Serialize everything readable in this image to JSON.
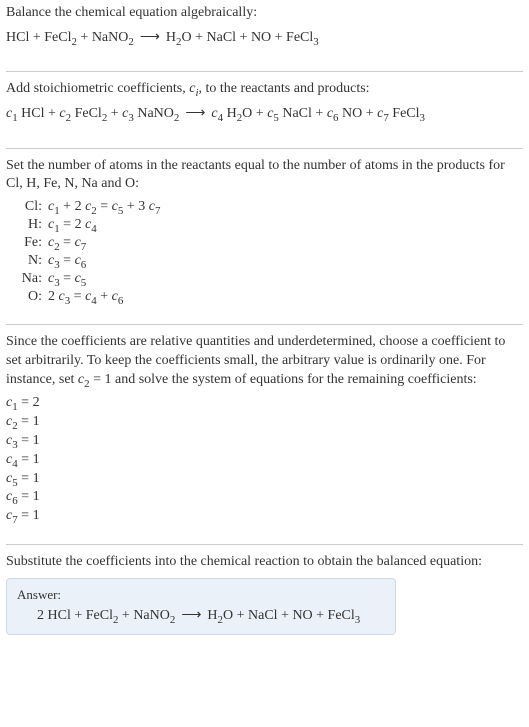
{
  "intro": {
    "title": "Balance the chemical equation algebraically:",
    "equation": "HCl + FeCl₂ + NaNO₂ ⟶ H₂O + NaCl + NO + FeCl₃"
  },
  "step1": {
    "text_before": "Add stoichiometric coefficients, ",
    "ci": "c",
    "ci_sub": "i",
    "text_after": ", to the reactants and products:",
    "equation": "c₁ HCl + c₂ FeCl₂ + c₃ NaNO₂ ⟶ c₄ H₂O + c₅ NaCl + c₆ NO + c₇ FeCl₃"
  },
  "step2": {
    "text": "Set the number of atoms in the reactants equal to the number of atoms in the products for Cl, H, Fe, N, Na and O:",
    "rows": [
      {
        "label": "Cl:",
        "eq": "c₁ + 2 c₂ = c₅ + 3 c₇"
      },
      {
        "label": "H:",
        "eq": "c₁ = 2 c₄"
      },
      {
        "label": "Fe:",
        "eq": "c₂ = c₇"
      },
      {
        "label": "N:",
        "eq": "c₃ = c₆"
      },
      {
        "label": "Na:",
        "eq": "c₃ = c₅"
      },
      {
        "label": "O:",
        "eq": "2 c₃ = c₄ + c₆"
      }
    ]
  },
  "step3": {
    "text_a": "Since the coefficients are relative quantities and underdetermined, choose a coefficient to set arbitrarily. To keep the coefficients small, the arbitrary value is ordinarily one. For instance, set ",
    "set": "c₂ = 1",
    "text_b": " and solve the system of equations for the remaining coefficients:",
    "coeffs": [
      "c₁ = 2",
      "c₂ = 1",
      "c₃ = 1",
      "c₄ = 1",
      "c₅ = 1",
      "c₆ = 1",
      "c₇ = 1"
    ]
  },
  "final": {
    "text": "Substitute the coefficients into the chemical reaction to obtain the balanced equation:",
    "answer_label": "Answer:",
    "equation": "2 HCl + FeCl₂ + NaNO₂ ⟶ H₂O + NaCl + NO + FeCl₃"
  }
}
